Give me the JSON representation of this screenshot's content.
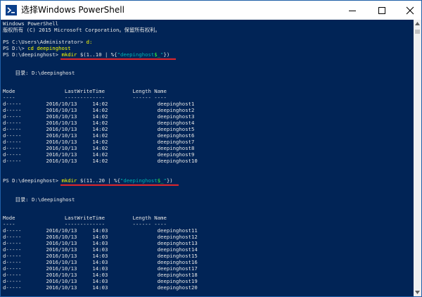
{
  "window": {
    "title": "选择Windows PowerShell"
  },
  "console": {
    "header": [
      "Windows PowerShell",
      "版权所有 (C) 2015 Microsoft Corporation。保留所有权利。"
    ],
    "cmd1": {
      "prompt": "PS C:\\Users\\Administrator> ",
      "command": "d:"
    },
    "cmd2": {
      "prompt": "PS D:\\> ",
      "command": "cd deepinghost"
    },
    "cmd3": {
      "prompt": "PS D:\\deepinghost> ",
      "command": "mkdir",
      "args_a": " $(1..10 | %{",
      "string": "\"deepinghost",
      "variable": "$_",
      "string_end": "\"",
      "args_b": "})"
    },
    "dir_label1": "    目录: D:\\deepinghost",
    "column_header": "Mode                LastWriteTime         Length Name",
    "column_rule": "----                -------------         ------ ----",
    "listing1": [
      "d-----        2016/10/13     14:02                deepinghost1",
      "d-----        2016/10/13     14:02                deepinghost2",
      "d-----        2016/10/13     14:02                deepinghost3",
      "d-----        2016/10/13     14:02                deepinghost4",
      "d-----        2016/10/13     14:02                deepinghost5",
      "d-----        2016/10/13     14:02                deepinghost6",
      "d-----        2016/10/13     14:02                deepinghost7",
      "d-----        2016/10/13     14:02                deepinghost8",
      "d-----        2016/10/13     14:02                deepinghost9",
      "d-----        2016/10/13     14:02                deepinghost10"
    ],
    "cmd4": {
      "prompt": "PS D:\\deepinghost> ",
      "command": "mkdir",
      "args_a": " $(11..20 | %{",
      "string": "\"deepinghost",
      "variable": "$_",
      "string_end": "\"",
      "args_b": "})"
    },
    "dir_label2": "    目录: D:\\deepinghost",
    "listing2": [
      "d-----        2016/10/13     14:03                deepinghost11",
      "d-----        2016/10/13     14:03                deepinghost12",
      "d-----        2016/10/13     14:03                deepinghost13",
      "d-----        2016/10/13     14:03                deepinghost14",
      "d-----        2016/10/13     14:03                deepinghost15",
      "d-----        2016/10/13     14:03                deepinghost16",
      "d-----        2016/10/13     14:03                deepinghost17",
      "d-----        2016/10/13     14:03                deepinghost18",
      "d-----        2016/10/13     14:03                deepinghost19",
      "d-----        2016/10/13     14:03                deepinghost20"
    ]
  },
  "colors": {
    "console_bg": "#012456",
    "highlight": "#ff0000",
    "command": "#ffff00"
  }
}
